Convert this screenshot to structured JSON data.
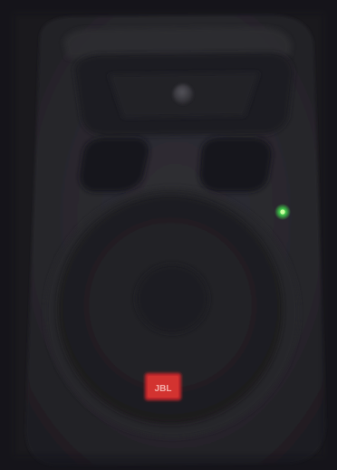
{
  "photo": {
    "subject": "speaker-cabinet",
    "power_led_color": "#3fd24a",
    "brand_badge_color": "#c8262b",
    "cabinet_color": "#2b2a30",
    "background_color": "#1a191d"
  },
  "badge": {
    "text": "JBL"
  }
}
